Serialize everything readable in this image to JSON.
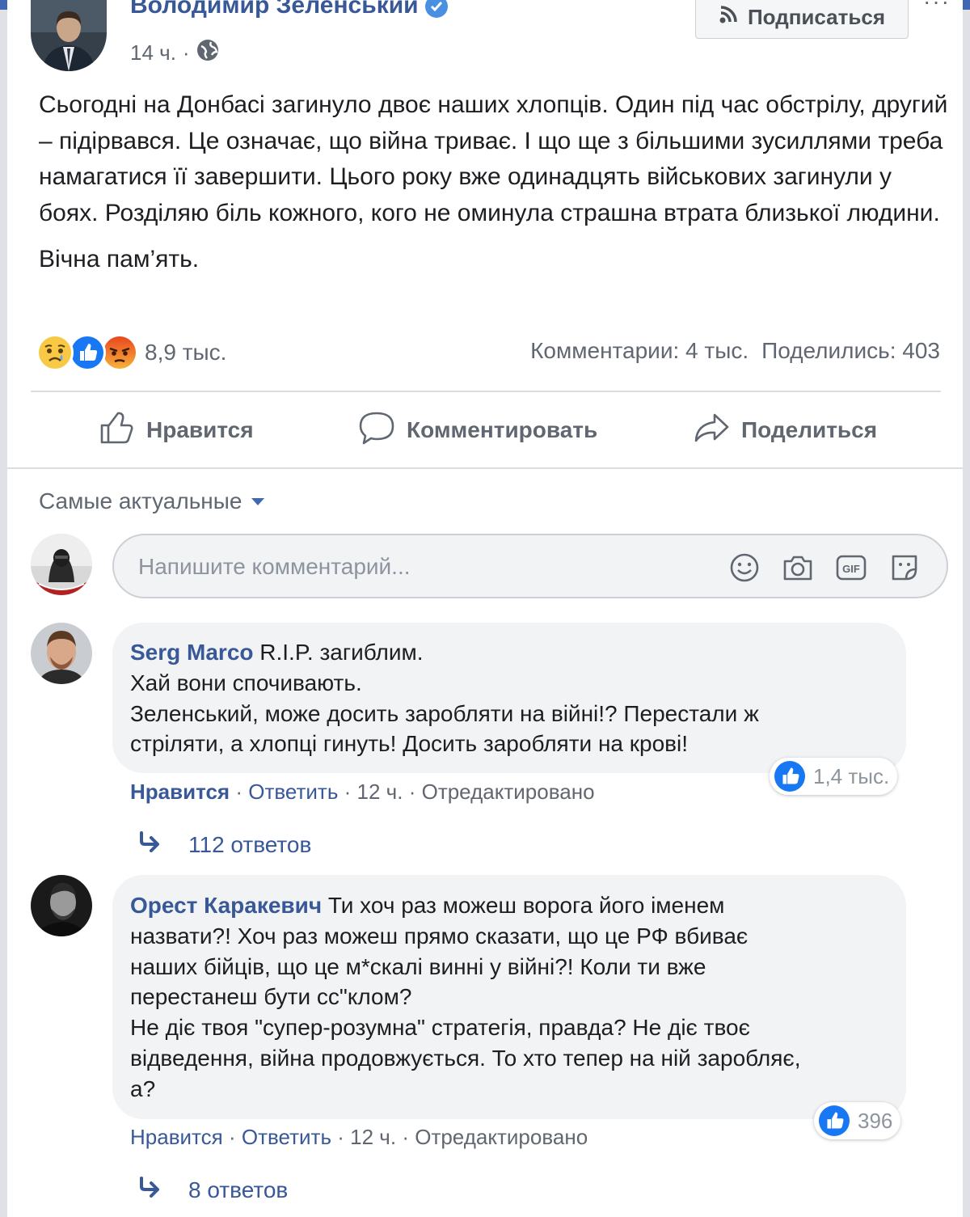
{
  "post": {
    "author": "Володимир Зеленський",
    "time": "14 ч.",
    "time_sep": "·",
    "follow_label": "Подписаться",
    "more_label": "···",
    "paragraphs": [
      "Сьогодні на Донбасі загинуло двоє наших хлопців. Один під час обстрілу, другий – підірвався. Це означає, що війна триває. І що ще з більшими зусиллями треба намагатися її завершити. Цього року вже одинадцять військових загинули у боях. Розділяю біль кожного, кого не оминула страшна втрата близької людини.",
      "Вічна пам’ять."
    ],
    "reactions_count": "8,9 тыс.",
    "comments_count": "Комментарии: 4 тыс.",
    "shares_count": "Поделились: 403",
    "reaction_icons": [
      "sad-reaction",
      "like-reaction",
      "angry-reaction"
    ]
  },
  "actions": {
    "like": "Нравится",
    "comment": "Комментировать",
    "share": "Поделиться"
  },
  "sort": {
    "label": "Самые актуальные"
  },
  "composer": {
    "placeholder": "Напишите комментарий...",
    "icons": [
      "emoji-icon",
      "camera-icon",
      "gif-icon",
      "sticker-icon"
    ]
  },
  "comments": [
    {
      "name": "Serg Marco",
      "first_line": " R.I.P. загиблим.",
      "lines": [
        "Хай вони спочивають.",
        "Зеленський, може досить заробляти на війні!? Перестали ж",
        "стріляти, а хлопці гинуть! Досить заробляти на крові!"
      ],
      "like": "Нравится",
      "reply": "Ответить",
      "time": "12 ч.",
      "edited": "Отредактировано",
      "sep": "·",
      "reactions": "1,4 тыс.",
      "replies": "112 ответов"
    },
    {
      "name": "Орест Каракевич",
      "first_line": " Ти хоч раз можеш ворога його іменем",
      "lines": [
        "назвати?! Хоч раз можеш прямо сказати, що це РФ вбиває",
        "наших бійців, що це м*скалі винні у війні?! Коли ти вже",
        "перестанеш бути сс\"клом?",
        "Не діє твоя \"супер-розумна\" стратегія, правда? Не діє твоє",
        "відведення, війна продовжується. То хто тепер на ній заробляє,",
        "а?"
      ],
      "like": "Нравится",
      "reply": "Ответить",
      "time": "12 ч.",
      "edited": "Отредактировано",
      "sep": "·",
      "reactions": "396",
      "replies": "8 ответов"
    }
  ],
  "colors": {
    "link": "#385898",
    "brand": "#4267b2",
    "like_blue": "#1877f2",
    "muted": "#606770"
  }
}
